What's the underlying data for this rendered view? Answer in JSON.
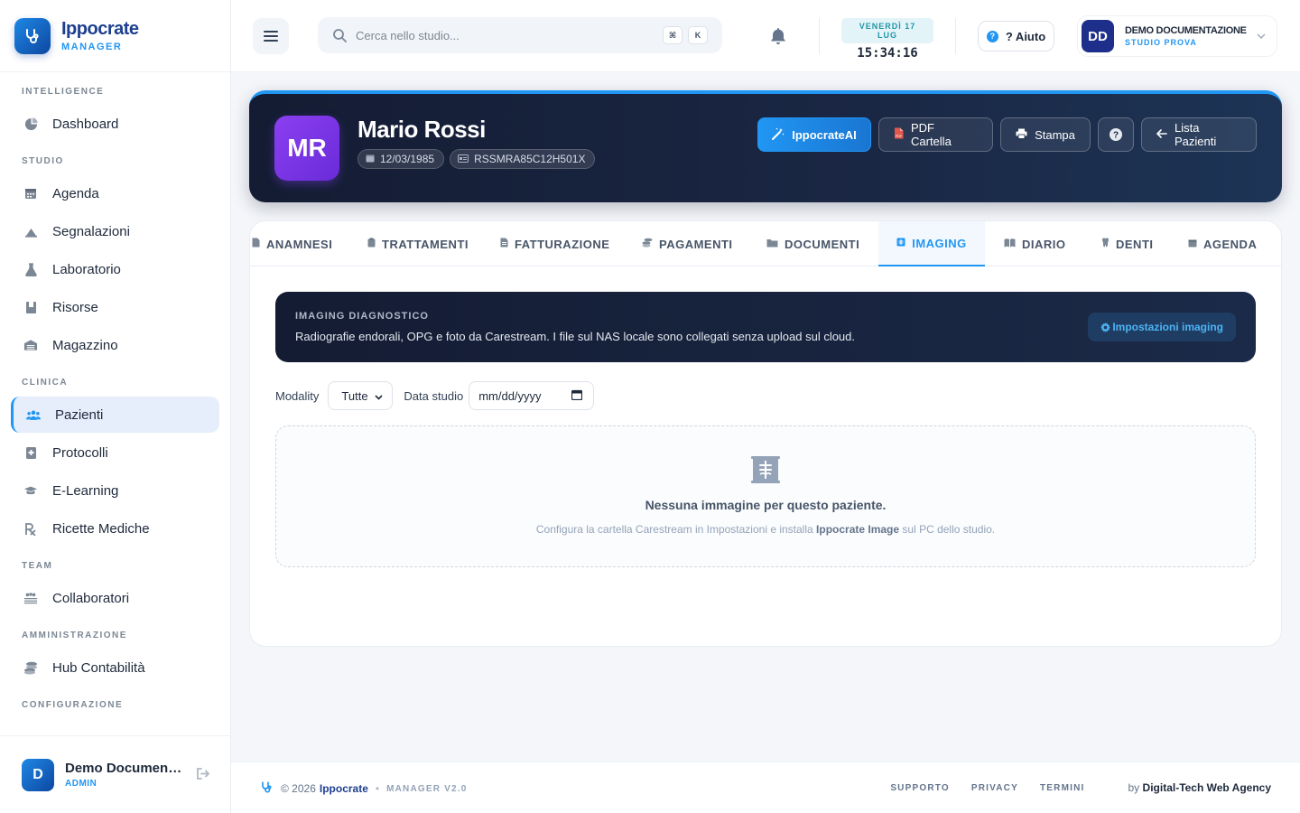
{
  "brand": {
    "name": "Ippocrate",
    "sub": "MANAGER"
  },
  "sidebar": {
    "sections": [
      {
        "title": "INTELLIGENCE",
        "items": [
          {
            "label": "Dashboard",
            "icon": "pie-chart-icon"
          }
        ]
      },
      {
        "title": "STUDIO",
        "items": [
          {
            "label": "Agenda",
            "icon": "calendar-icon"
          },
          {
            "label": "Segnalazioni",
            "icon": "flag-icon"
          },
          {
            "label": "Laboratorio",
            "icon": "flask-icon"
          },
          {
            "label": "Risorse",
            "icon": "box-icon"
          },
          {
            "label": "Magazzino",
            "icon": "warehouse-icon"
          }
        ]
      },
      {
        "title": "CLINICA",
        "items": [
          {
            "label": "Pazienti",
            "icon": "users-icon",
            "active": true
          },
          {
            "label": "Protocolli",
            "icon": "book-icon"
          },
          {
            "label": "E-Learning",
            "icon": "graduation-cap-icon"
          },
          {
            "label": "Ricette Mediche",
            "icon": "prescription-icon"
          }
        ]
      },
      {
        "title": "TEAM",
        "items": [
          {
            "label": "Collaboratori",
            "icon": "team-icon"
          }
        ]
      },
      {
        "title": "AMMINISTRAZIONE",
        "items": [
          {
            "label": "Hub Contabilità",
            "icon": "coins-icon"
          }
        ]
      },
      {
        "title": "CONFIGURAZIONE",
        "items": []
      }
    ],
    "user": {
      "initial": "D",
      "name": "Demo Documenta...",
      "role": "ADMIN"
    }
  },
  "topbar": {
    "search_placeholder": "Cerca nello studio...",
    "kbd1": "⌘",
    "kbd2": "K",
    "date": "VENERDÌ 17 LUG",
    "time": "15:34:16",
    "help": "? Aiuto",
    "profile": {
      "initials": "DD",
      "name": "DEMO DOCUMENTAZIONE",
      "studio": "STUDIO PROVA"
    }
  },
  "patient": {
    "initials": "MR",
    "name": "Mario Rossi",
    "dob": "12/03/1985",
    "fiscal_code": "RSSMRA85C12H501X",
    "actions": {
      "ai": "IppocrateAI",
      "pdf": "PDF Cartella",
      "print": "Stampa",
      "back": "Lista Pazienti"
    }
  },
  "tabs": [
    {
      "label": "ANAMNESI",
      "icon": "file-icon"
    },
    {
      "label": "TRATTAMENTI",
      "icon": "clipboard-icon"
    },
    {
      "label": "FATTURAZIONE",
      "icon": "invoice-icon"
    },
    {
      "label": "PAGAMENTI",
      "icon": "money-icon"
    },
    {
      "label": "DOCUMENTI",
      "icon": "folder-icon"
    },
    {
      "label": "IMAGING",
      "icon": "xray-icon",
      "active": true
    },
    {
      "label": "DIARIO",
      "icon": "book-open-icon"
    },
    {
      "label": "DENTI",
      "icon": "tooth-icon"
    },
    {
      "label": "AGENDA",
      "icon": "calendar-icon"
    }
  ],
  "imaging": {
    "kicker": "IMAGING DIAGNOSTICO",
    "text": "Radiografie endorali, OPG e foto da Carestream. I file sul NAS locale sono collegati senza upload sul cloud.",
    "settings_button": "Impostazioni imaging",
    "filter_modality_label": "Modality",
    "filter_modality_value": "Tutte",
    "filter_date_label": "Data studio",
    "filter_date_placeholder": "mm/dd/yyyy",
    "empty_title": "Nessuna immagine per questo paziente.",
    "empty_desc_pre": "Configura la cartella Carestream in Impostazioni e installa ",
    "empty_desc_bold": "Ippocrate Image",
    "empty_desc_post": " sul PC dello studio."
  },
  "footer": {
    "copyright": "© 2026",
    "brand": "Ippocrate",
    "version": "MANAGER V2.0",
    "links": [
      "SUPPORTO",
      "PRIVACY",
      "TERMINI"
    ],
    "by_prefix": "by",
    "agency": "Digital-Tech Web Agency"
  },
  "colors": {
    "accent": "#2196f3",
    "dark": "#141c33",
    "avatar_purple": "#7b35e6"
  }
}
